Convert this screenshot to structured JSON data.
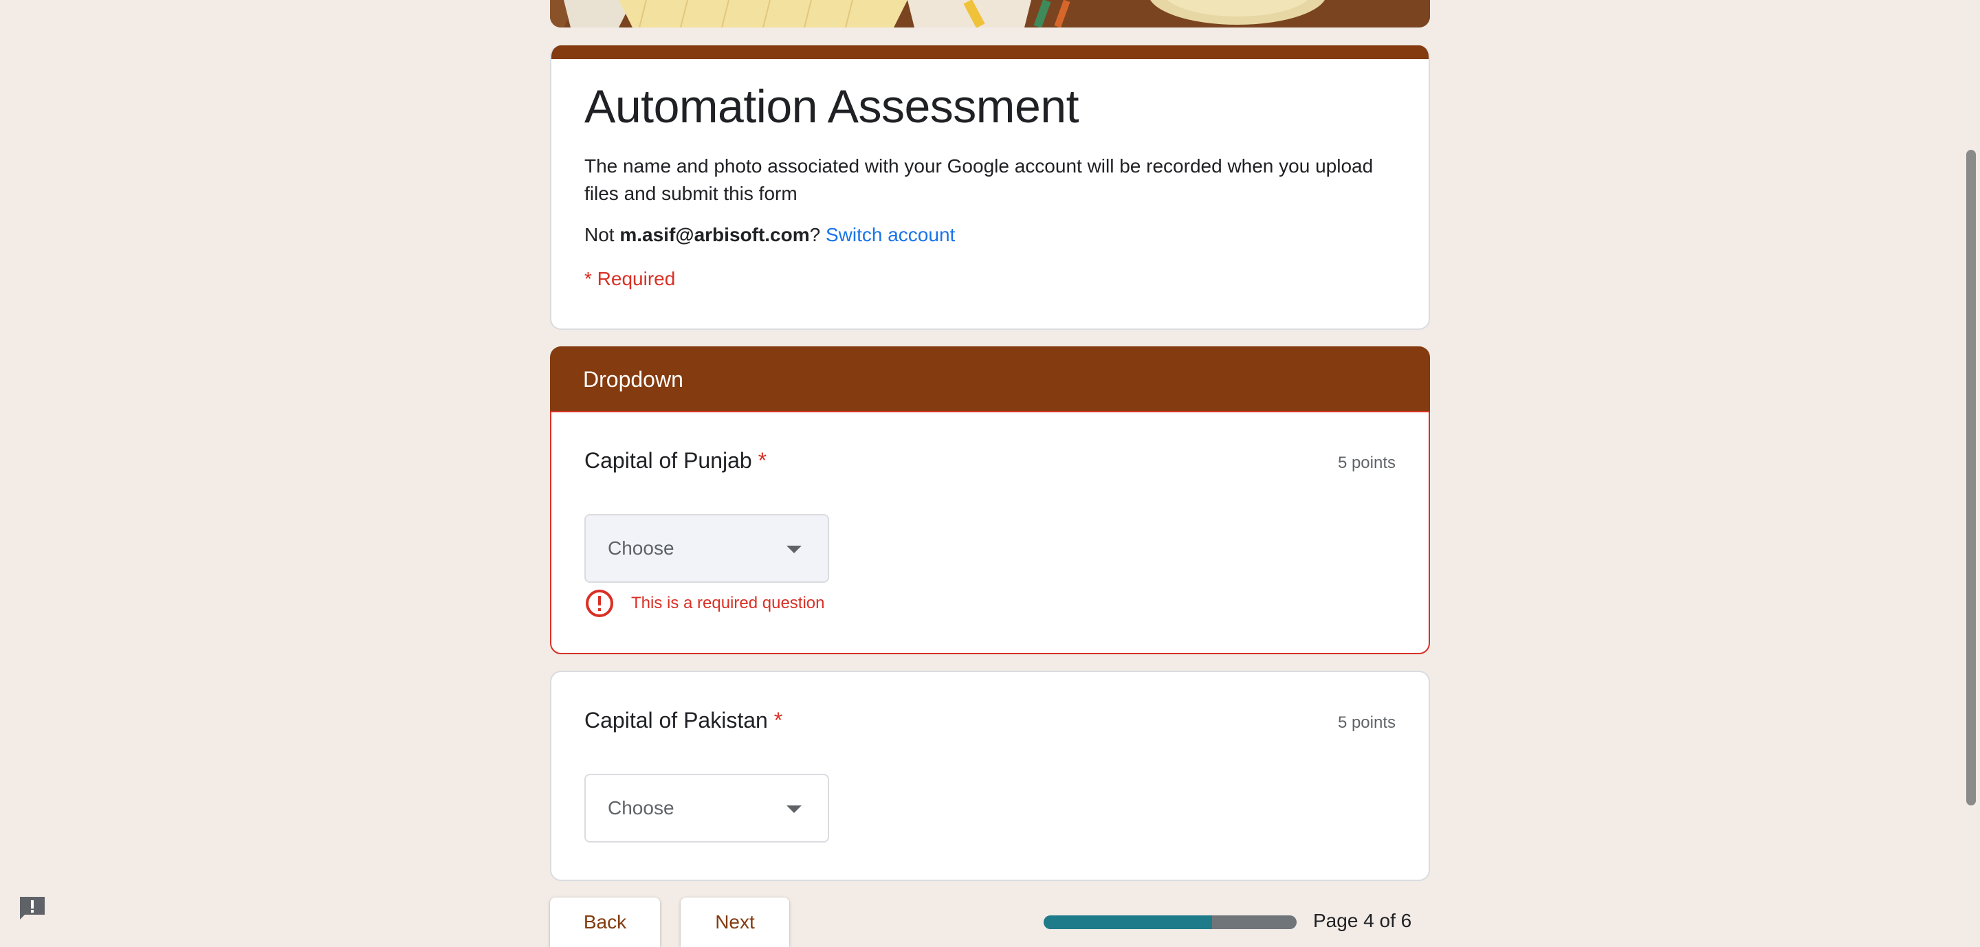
{
  "form": {
    "title": "Automation Assessment",
    "description": "The name and photo associated with your Google account will be recorded when you upload files and submit this form",
    "account_prefix": "Not ",
    "account_email": "m.asif@arbisoft.com",
    "account_suffix": "? ",
    "switch_account": "Switch account",
    "required_note": "* Required"
  },
  "section": {
    "title": "Dropdown"
  },
  "questions": [
    {
      "title": "Capital of Punjab",
      "required_mark": "*",
      "points": "5 points",
      "placeholder": "Choose",
      "error": "This is a required question"
    },
    {
      "title": "Capital of Pakistan",
      "required_mark": "*",
      "points": "5 points",
      "placeholder": "Choose"
    }
  ],
  "navigation": {
    "back_label": "Back",
    "next_label": "Next",
    "page_label": "Page 4 of 6",
    "progress_fraction": 0.667
  },
  "colors": {
    "theme": "#843b0f",
    "error": "#d93025",
    "link": "#1a73e8",
    "progress": "#1e7b8a",
    "background": "#f2ebe6"
  },
  "icons": {
    "error": "error-circle-icon",
    "dropdown": "dropdown-arrow-icon",
    "feedback": "feedback-icon"
  }
}
